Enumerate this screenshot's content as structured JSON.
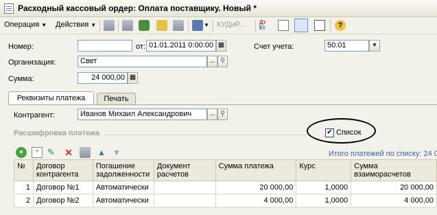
{
  "window": {
    "title": "Расходный кассовый ордер: Оплата поставщику. Новый *"
  },
  "toolbar": {
    "operation": "Операция",
    "actions": "Действия",
    "kud": "КУДиР..."
  },
  "header": {
    "number_label": "Номер:",
    "number_value": "",
    "date_label": "от:",
    "date_value": "01.01.2011  0:00:00",
    "account_label": "Счет учета:",
    "account_value": "50.01",
    "org_label": "Организация:",
    "org_value": "Свет",
    "sum_label": "Сумма:",
    "sum_value": "24 000,00"
  },
  "tabs": [
    {
      "label": "Реквизиты платежа"
    },
    {
      "label": "Печать"
    }
  ],
  "contractor": {
    "label": "Контрагент:",
    "value": "Иванов Михаил Александрович"
  },
  "payment": {
    "section_title": "Расшифровка платежа",
    "list_label": "Список",
    "list_checked": "✔",
    "total_text": "Итого платежей по списку: 24 0"
  },
  "table": {
    "columns": [
      "№",
      "Договор контрагента",
      "Погашение задолженности",
      "Документ расчетов",
      "Сумма платежа",
      "Курс",
      "Сумма взаиморасчетов"
    ],
    "rows": [
      [
        "1",
        "Договор №1",
        "Автоматически",
        "",
        "20 000,00",
        "1,0000",
        "20 000,00"
      ],
      [
        "2",
        "Договор №2",
        "Автоматически",
        "",
        "4 000,00",
        "1,0000",
        "4 000,00"
      ]
    ]
  }
}
